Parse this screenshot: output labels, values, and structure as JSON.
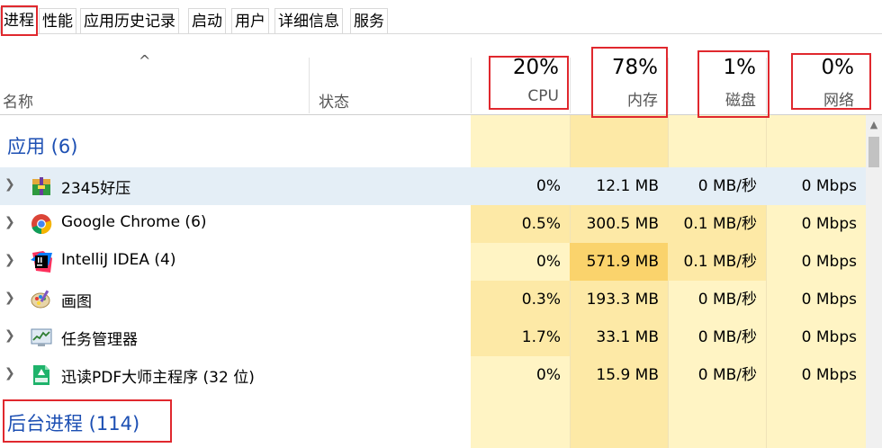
{
  "tabs": [
    {
      "label": "进程"
    },
    {
      "label": "性能"
    },
    {
      "label": "应用历史记录"
    },
    {
      "label": "启动"
    },
    {
      "label": "用户"
    },
    {
      "label": "详细信息"
    },
    {
      "label": "服务"
    }
  ],
  "header": {
    "name_label": "名称",
    "status_label": "状态",
    "sort_indicator": "^",
    "cpu": {
      "percent": "20%",
      "label": "CPU"
    },
    "memory": {
      "percent": "78%",
      "label": "内存"
    },
    "disk": {
      "percent": "1%",
      "label": "磁盘"
    },
    "network": {
      "percent": "0%",
      "label": "网络"
    }
  },
  "groups": {
    "apps": {
      "title": "应用 (6)"
    },
    "background": {
      "title": "后台进程 (114)"
    }
  },
  "processes": [
    {
      "name": "2345好压",
      "icon": "archive-icon",
      "cpu": "0%",
      "memory": "12.1 MB",
      "disk": "0 MB/秒",
      "network": "0 Mbps"
    },
    {
      "name": "Google Chrome (6)",
      "icon": "chrome-icon",
      "cpu": "0.5%",
      "memory": "300.5 MB",
      "disk": "0.1 MB/秒",
      "network": "0 Mbps"
    },
    {
      "name": "IntelliJ IDEA (4)",
      "icon": "intellij-icon",
      "cpu": "0%",
      "memory": "571.9 MB",
      "disk": "0.1 MB/秒",
      "network": "0 Mbps"
    },
    {
      "name": "画图",
      "icon": "paint-icon",
      "cpu": "0.3%",
      "memory": "193.3 MB",
      "disk": "0 MB/秒",
      "network": "0 Mbps"
    },
    {
      "name": "任务管理器",
      "icon": "task-manager-icon",
      "cpu": "1.7%",
      "memory": "33.1 MB",
      "disk": "0 MB/秒",
      "network": "0 Mbps"
    },
    {
      "name": "迅读PDF大师主程序 (32 位)",
      "icon": "pdf-icon",
      "cpu": "0%",
      "memory": "15.9 MB",
      "disk": "0 MB/秒",
      "network": "0 Mbps"
    }
  ],
  "colors": {
    "heat_light": "#fff4c4",
    "heat_medium": "#fde9a6",
    "heat_strong": "#fad36c",
    "group_title": "#1c4fb3",
    "annotation": "#e0282e"
  }
}
